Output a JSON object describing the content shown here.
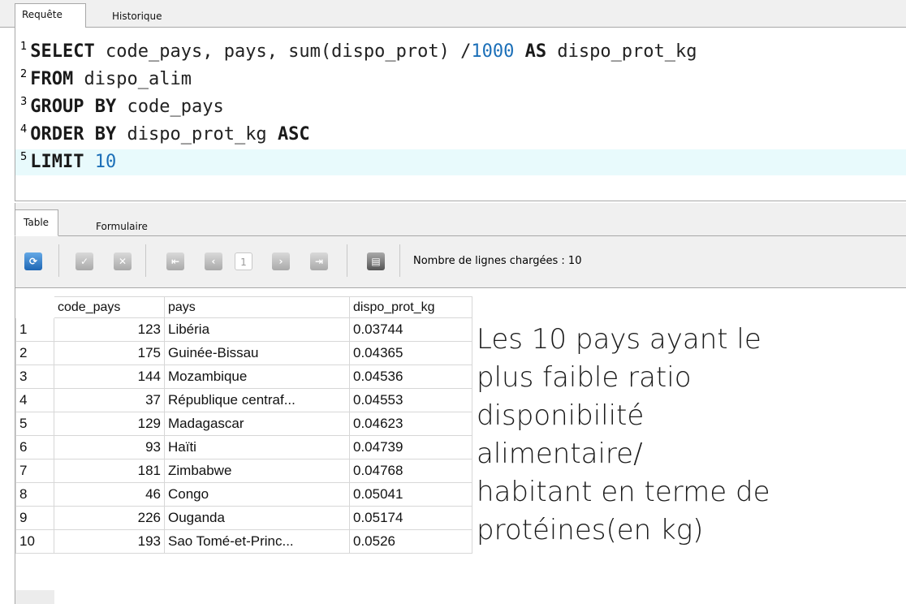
{
  "tabs_top": [
    "Requête",
    "Historique"
  ],
  "editor": {
    "lines": [
      {
        "n": "1",
        "parts": [
          {
            "t": "SELECT",
            "c": "kw"
          },
          {
            "t": " code_pays, pays, sum(dispo_prot) /",
            "c": "plain"
          },
          {
            "t": "1000",
            "c": "num"
          },
          {
            "t": " ",
            "c": "plain"
          },
          {
            "t": "AS",
            "c": "kw"
          },
          {
            "t": " dispo_prot_kg",
            "c": "plain"
          }
        ]
      },
      {
        "n": "2",
        "parts": [
          {
            "t": "FROM",
            "c": "kw"
          },
          {
            "t": " dispo_alim",
            "c": "plain"
          }
        ]
      },
      {
        "n": "3",
        "parts": [
          {
            "t": "GROUP BY",
            "c": "kw"
          },
          {
            "t": " code_pays",
            "c": "plain"
          }
        ]
      },
      {
        "n": "4",
        "parts": [
          {
            "t": "ORDER BY",
            "c": "kw"
          },
          {
            "t": " dispo_prot_kg ",
            "c": "plain"
          },
          {
            "t": "ASC",
            "c": "kw"
          }
        ]
      },
      {
        "n": "5",
        "parts": [
          {
            "t": "LIMIT",
            "c": "kw"
          },
          {
            "t": " ",
            "c": "plain"
          },
          {
            "t": "10",
            "c": "num"
          }
        ]
      }
    ]
  },
  "tabs_bottom": [
    "Table",
    "Formulaire"
  ],
  "toolbar": {
    "page_number": "1",
    "row_count_label": "Nombre de lignes chargées : 10",
    "icons": [
      "refresh-icon",
      "commit-icon",
      "rollback-icon",
      "first-page-icon",
      "previous-page-icon",
      "next-page-icon",
      "last-page-icon",
      "print-icon"
    ]
  },
  "table": {
    "columns": [
      "code_pays",
      "pays",
      "dispo_prot_kg"
    ],
    "rows": [
      {
        "idx": "1",
        "code": "123",
        "pays": "Libéria",
        "dispo": "0.03744"
      },
      {
        "idx": "2",
        "code": "175",
        "pays": "Guinée-Bissau",
        "dispo": "0.04365"
      },
      {
        "idx": "3",
        "code": "144",
        "pays": "Mozambique",
        "dispo": "0.04536"
      },
      {
        "idx": "4",
        "code": "37",
        "pays": "République centraf...",
        "dispo": "0.04553"
      },
      {
        "idx": "5",
        "code": "129",
        "pays": "Madagascar",
        "dispo": "0.04623"
      },
      {
        "idx": "6",
        "code": "93",
        "pays": "Haïti",
        "dispo": "0.04739"
      },
      {
        "idx": "7",
        "code": "181",
        "pays": "Zimbabwe",
        "dispo": "0.04768"
      },
      {
        "idx": "8",
        "code": "46",
        "pays": "Congo",
        "dispo": "0.05041"
      },
      {
        "idx": "9",
        "code": "226",
        "pays": "Ouganda",
        "dispo": "0.05174"
      },
      {
        "idx": "10",
        "code": "193",
        "pays": "Sao Tomé-et-Princ...",
        "dispo": "0.0526"
      }
    ]
  },
  "caption": [
    "Les 10 pays ayant le",
    "plus faible ratio",
    "disponibilité",
    "alimentaire/",
    "habitant en terme de",
    "protéines(en kg)"
  ],
  "colors": {
    "current_line": "#e8fafc",
    "number": "#1b6fb8",
    "refresh": "#1e66b4"
  }
}
